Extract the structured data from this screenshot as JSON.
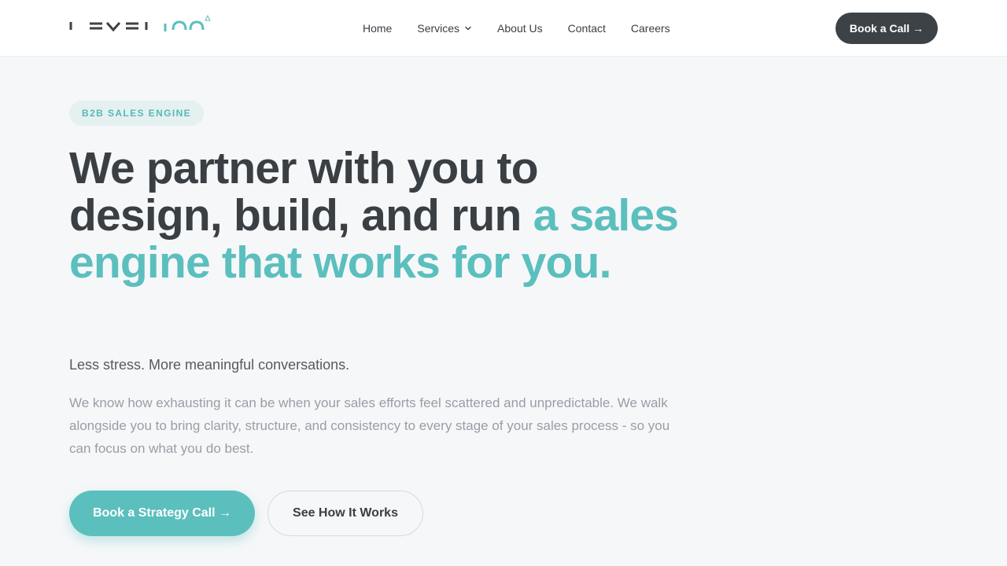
{
  "brand": {
    "logo_text": "LEVEL 100",
    "colors": {
      "accent": "#5bbfbe",
      "dark": "#3d4246",
      "badge_bg": "#e4f1f0"
    }
  },
  "nav": {
    "items": [
      {
        "label": "Home"
      },
      {
        "label": "Services",
        "has_dropdown": true
      },
      {
        "label": "About Us"
      },
      {
        "label": "Contact"
      },
      {
        "label": "Careers"
      }
    ],
    "cta_label": "Book a Call →"
  },
  "hero": {
    "badge": "B2B SALES ENGINE",
    "headline_plain": "We partner with you to design, build, and run",
    "headline_accent": "a sales engine that works for you.",
    "subhead": "Less stress. More meaningful conversations.",
    "body": "We know how exhausting it can be when your sales efforts feel scattered and unpredictable. We walk alongside you to bring clarity, structure, and consistency to every stage of your sales process - so you can focus on what you do best.",
    "primary_cta": "Book a Strategy Call →",
    "secondary_cta": "See How It Works"
  },
  "icons": {
    "dropdown": "chevron-down-icon"
  }
}
